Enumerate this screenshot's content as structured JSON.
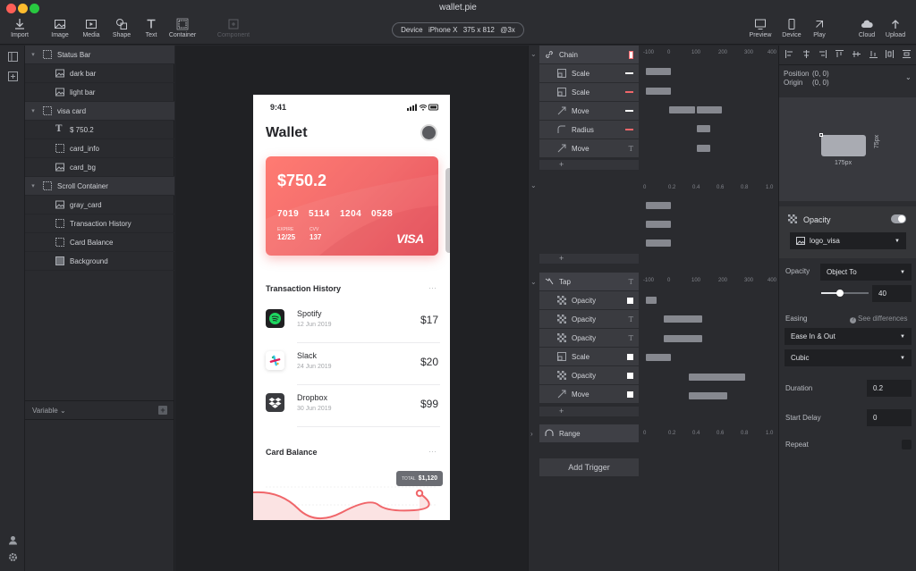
{
  "window": {
    "title": "wallet.pie"
  },
  "toolbar": {
    "import": "Import",
    "image": "Image",
    "media": "Media",
    "shape": "Shape",
    "text": "Text",
    "container": "Container",
    "component": "Component",
    "preview": "Preview",
    "device": "Device",
    "play": "Play",
    "cloud": "Cloud",
    "upload": "Upload"
  },
  "device_pill": {
    "label": "Device",
    "model": "iPhone X",
    "size": "375 x 812",
    "scale": "@3x"
  },
  "layers": [
    {
      "label": "Status Bar",
      "type": "container",
      "expanded": true
    },
    {
      "label": "dark bar",
      "type": "image"
    },
    {
      "label": "light bar",
      "type": "image"
    },
    {
      "label": "visa card",
      "type": "container",
      "expanded": true
    },
    {
      "label": "$ 750.2",
      "type": "text"
    },
    {
      "label": "card_info",
      "type": "container"
    },
    {
      "label": "card_bg",
      "type": "image"
    },
    {
      "label": "Scroll Container",
      "type": "container",
      "expanded": true
    },
    {
      "label": "gray_card",
      "type": "image"
    },
    {
      "label": "Transaction History",
      "type": "container"
    },
    {
      "label": "Card Balance",
      "type": "container"
    },
    {
      "label": "Background",
      "type": "image"
    }
  ],
  "variable": {
    "label": "Variable"
  },
  "phone": {
    "time": "9:41",
    "title": "Wallet",
    "card": {
      "amount": "$750.2",
      "numbers": [
        "7019",
        "5114",
        "1204",
        "0528"
      ],
      "expire_label": "EXPIRE",
      "expire": "12/25",
      "cvv_label": "CVV",
      "cvv": "137",
      "brand": "VISA"
    },
    "transaction_title": "Transaction History",
    "more": "···",
    "transactions": [
      {
        "name": "Spotify",
        "date": "12 Jun 2019",
        "price": "$17",
        "color": "#1f1f21"
      },
      {
        "name": "Slack",
        "date": "24 Jun 2019",
        "price": "$20",
        "color": "#ffffff"
      },
      {
        "name": "Dropbox",
        "date": "30 Jun 2019",
        "price": "$99",
        "color": "#3a3b3f"
      }
    ],
    "balance_title": "Card Balance",
    "total_label": "TOTAL",
    "total_value": "$1,120"
  },
  "timeline": {
    "ruler_px": [
      "-100",
      "0",
      "100",
      "200",
      "300",
      "400"
    ],
    "ruler_unit": [
      "0",
      "0.2",
      "0.4",
      "0.6",
      "0.8",
      "1.0"
    ],
    "chain": {
      "label": "Chain",
      "rows": [
        {
          "label": "Scale",
          "marker": "white"
        },
        {
          "label": "Scale",
          "marker": "red"
        },
        {
          "label": "Move",
          "marker": "white"
        },
        {
          "label": "Radius",
          "marker": "red"
        },
        {
          "label": "Move",
          "marker": "T"
        }
      ]
    },
    "tap": {
      "label": "Tap",
      "rows": [
        {
          "label": "Opacity",
          "marker": "white"
        },
        {
          "label": "Opacity",
          "marker": "T"
        },
        {
          "label": "Opacity",
          "marker": "T"
        },
        {
          "label": "Scale",
          "marker": "white"
        },
        {
          "label": "Opacity",
          "marker": "white"
        },
        {
          "label": "Move",
          "marker": "white"
        }
      ]
    },
    "range": {
      "label": "Range"
    },
    "plus": "+",
    "add_trigger": "Add Trigger"
  },
  "inspector": {
    "position_label": "Position",
    "position": "(0, 0)",
    "origin_label": "Origin",
    "origin": "(0, 0)",
    "preview_w": "175px",
    "preview_h": "75px",
    "section": "Opacity",
    "target": "logo_visa",
    "opacity_label": "Opacity",
    "opacity_mode": "Object To",
    "opacity_value": "40",
    "opacity_slider": 0.4,
    "easing_label": "Easing",
    "see_diff": "See differences",
    "easing": "Ease In & Out",
    "curve": "Cubic",
    "duration_label": "Duration",
    "duration": "0.2",
    "delay_label": "Start Delay",
    "delay": "0",
    "repeat_label": "Repeat"
  },
  "colors": {
    "accent_red": "#f0666a",
    "card_start": "#ff7b72",
    "card_end": "#e8505a"
  }
}
